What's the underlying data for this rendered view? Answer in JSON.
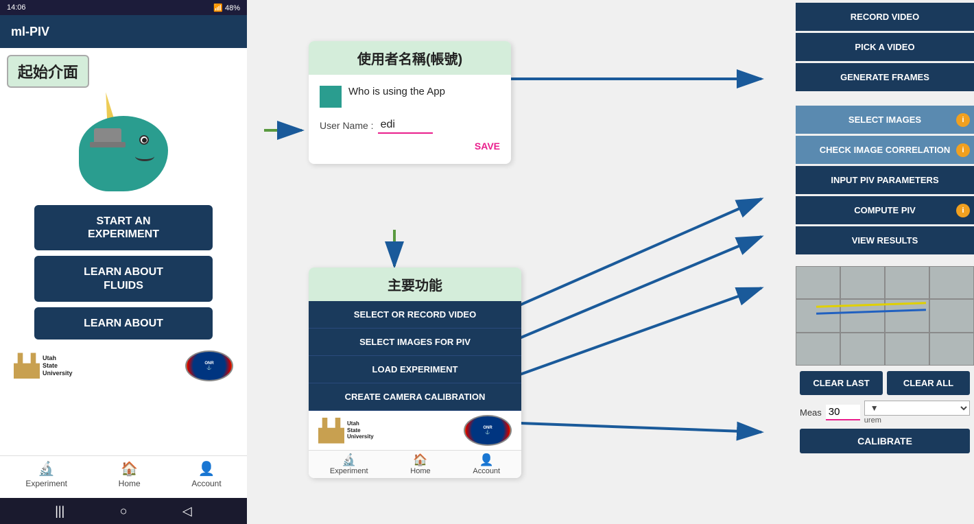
{
  "phone": {
    "status_bar": {
      "time": "14:06",
      "battery": "48%"
    },
    "title": "ml-PIV",
    "label": "起始介面",
    "buttons": [
      {
        "id": "start-experiment",
        "label": "START AN\nEXPERIMENT"
      },
      {
        "id": "learn-fluids",
        "label": "LEARN ABOUT\nFLUIDS"
      },
      {
        "id": "learn-about",
        "label": "LEARN ABOUT"
      }
    ],
    "nav": [
      {
        "id": "experiment",
        "label": "Experiment",
        "icon": "🔬"
      },
      {
        "id": "home",
        "label": "Home",
        "icon": "🏠"
      },
      {
        "id": "account",
        "label": "Account",
        "icon": "👤"
      }
    ]
  },
  "username_screen": {
    "title": "使用者名稱(帳號)",
    "who_label": "Who is using the App",
    "username_label": "User Name :",
    "username_value": "edi",
    "save_label": "SAVE"
  },
  "main_func_screen": {
    "title": "主要功能",
    "buttons": [
      {
        "id": "select-record",
        "label": "SELECT OR RECORD VIDEO"
      },
      {
        "id": "select-images",
        "label": "SELECT IMAGES FOR PIV"
      },
      {
        "id": "load-experiment",
        "label": "LOAD EXPERIMENT"
      },
      {
        "id": "create-calibration",
        "label": "CREATE CAMERA CALIBRATION"
      }
    ],
    "nav": [
      {
        "id": "experiment",
        "label": "Experiment",
        "icon": "🔬"
      },
      {
        "id": "home",
        "label": "Home",
        "icon": "🏠"
      },
      {
        "id": "account",
        "label": "Account",
        "icon": "👤"
      }
    ]
  },
  "right_panel": {
    "top_buttons": [
      {
        "id": "record-video",
        "label": "RECORD VIDEO",
        "style": "dark"
      },
      {
        "id": "pick-video",
        "label": "PICK A VIDEO",
        "style": "dark"
      },
      {
        "id": "generate-frames",
        "label": "GENERATE FRAMES",
        "style": "dark"
      }
    ],
    "bottom_buttons": [
      {
        "id": "select-images",
        "label": "SELECT IMAGES",
        "style": "light",
        "info": true
      },
      {
        "id": "check-image",
        "label": "CHECK IMAGE CORRELATION",
        "style": "light",
        "info": true
      },
      {
        "id": "input-piv",
        "label": "INPUT PIV PARAMETERS",
        "style": "dark"
      },
      {
        "id": "compute-piv",
        "label": "COMPUTE PIV",
        "style": "dark",
        "info": true
      },
      {
        "id": "view-results",
        "label": "VIEW RESULTS",
        "style": "dark"
      }
    ],
    "camera_alt": "calibration camera view",
    "clear_last": "CLEAR LAST",
    "clear_all": "CLEAR ALL",
    "meas_label": "Meas",
    "meas_value": "30",
    "meas_sublabel": "urem",
    "calibrate_label": "CALIBRATE"
  }
}
